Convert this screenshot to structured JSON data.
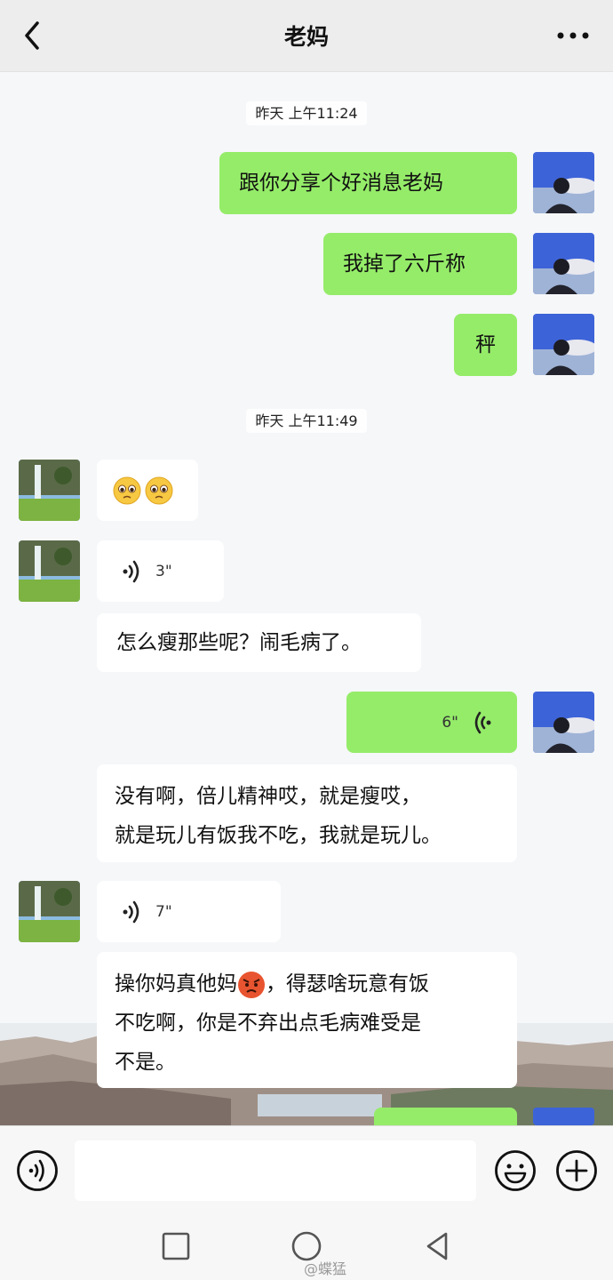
{
  "header": {
    "title": "老妈",
    "back_icon": "chevron-left-icon",
    "more_icon": "more-dots-icon"
  },
  "timestamps": [
    "昨天 上午11:24",
    "昨天 上午11:49"
  ],
  "messages": [
    {
      "side": "me",
      "type": "text",
      "text": "跟你分享个好消息老妈"
    },
    {
      "side": "me",
      "type": "text",
      "text": "我掉了六斤称"
    },
    {
      "side": "me",
      "type": "text",
      "text": "秤"
    },
    {
      "side": "other",
      "type": "emoji",
      "emojis": [
        "pleading-face-icon",
        "pleading-face-icon"
      ]
    },
    {
      "side": "other",
      "type": "voice",
      "duration": "3\""
    },
    {
      "side": "other",
      "type": "text",
      "text": "怎么瘦那些呢？闹毛病了。"
    },
    {
      "side": "me",
      "type": "voice",
      "duration": "6\""
    },
    {
      "side": "other",
      "type": "text",
      "lines": [
        "没有啊，倍儿精神哎，就是瘦哎，",
        "就是玩儿有饭我不吃，我就是玩儿。"
      ]
    },
    {
      "side": "other",
      "type": "voice",
      "duration": "7\""
    },
    {
      "side": "other",
      "type": "text",
      "lines": [
        "操你妈真他妈",
        "，得瑟啥玩意有饭",
        "不吃啊，你是不弃出点毛病难受是",
        "不是。"
      ],
      "emoji": "angry-face-icon"
    }
  ],
  "colors": {
    "my_bubble": "#95ec69",
    "other_bubble": "#ffffff",
    "header_bg": "#ededed"
  },
  "inputbar": {
    "placeholder": "",
    "voice_icon": "voice-mode-icon",
    "emoji_icon": "smiley-icon",
    "plus_icon": "plus-icon"
  },
  "navbar": {
    "icons": [
      "square-recents-icon",
      "circle-home-icon",
      "triangle-back-icon"
    ],
    "watermark": "@蝶猛"
  }
}
